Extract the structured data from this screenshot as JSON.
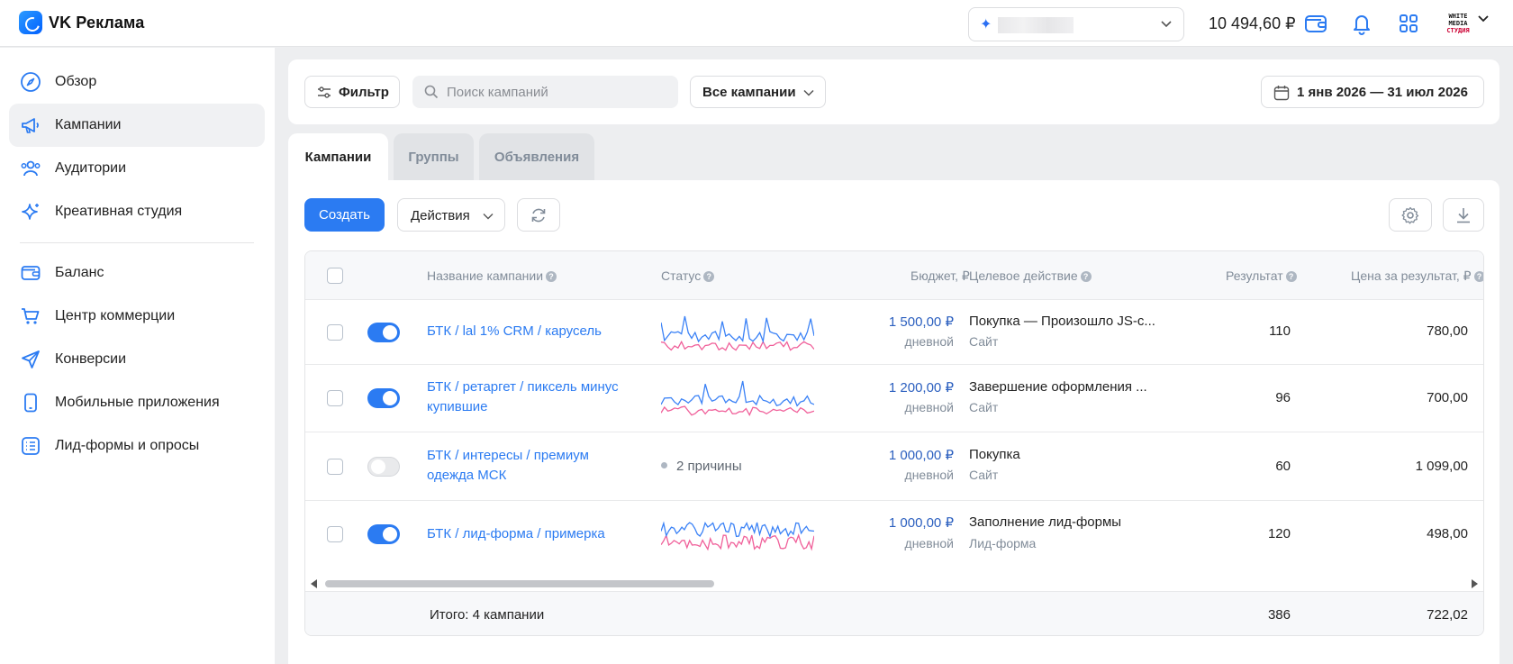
{
  "header": {
    "app_name": "VK Реклама",
    "balance": "10 494,60 ₽",
    "avatar_logo": [
      "WHITE",
      "MEDIA",
      "СТУДИЯ"
    ]
  },
  "sidebar": {
    "items": [
      {
        "label": "Обзор",
        "icon": "compass-icon"
      },
      {
        "label": "Кампании",
        "icon": "megaphone-icon",
        "active": true
      },
      {
        "label": "Аудитории",
        "icon": "users-icon"
      },
      {
        "label": "Креативная студия",
        "icon": "sparkle-icon"
      },
      {
        "label": "Баланс",
        "icon": "wallet-icon"
      },
      {
        "label": "Центр коммерции",
        "icon": "cart-icon"
      },
      {
        "label": "Конверсии",
        "icon": "send-icon"
      },
      {
        "label": "Мобильные приложения",
        "icon": "phone-icon"
      },
      {
        "label": "Лид-формы и опросы",
        "icon": "list-icon"
      }
    ]
  },
  "filterbar": {
    "filter_label": "Фильтр",
    "search_placeholder": "Поиск кампаний",
    "campaigns_select": "Все кампании",
    "date_range": "1 янв 2026 — 31 июл 2026"
  },
  "tabs": [
    {
      "label": "Кампании",
      "active": true
    },
    {
      "label": "Группы"
    },
    {
      "label": "Объявления"
    }
  ],
  "toolbar": {
    "create_label": "Создать",
    "actions_label": "Действия"
  },
  "table": {
    "columns": {
      "name": "Название кампании",
      "status": "Статус",
      "budget": "Бюджет, ₽",
      "goal": "Целевое действие",
      "result": "Результат",
      "price": "Цена за результат, ₽"
    },
    "rows": [
      {
        "name": "БТК / lal 1% CRM / карусель",
        "enabled": true,
        "status": "",
        "budget": "1 500,00 ₽",
        "budget_period": "дневной",
        "goal": "Покупка — Произошло JS-с...",
        "goal_sub": "Сайт",
        "result": "110",
        "price": "780,00"
      },
      {
        "name": "БТК / ретаргет / пиксель минус купившие",
        "enabled": true,
        "status": "",
        "budget": "1 200,00 ₽",
        "budget_period": "дневной",
        "goal": "Завершение оформления ...",
        "goal_sub": "Сайт",
        "result": "96",
        "price": "700,00"
      },
      {
        "name": "БТК / интересы / премиум одежда МСК",
        "enabled": false,
        "status": "2 причины",
        "budget": "1 000,00 ₽",
        "budget_period": "дневной",
        "goal": "Покупка",
        "goal_sub": "Сайт",
        "result": "60",
        "price": "1 099,00"
      },
      {
        "name": "БТК / лид-форма / примерка",
        "enabled": true,
        "status": "",
        "budget": "1 000,00 ₽",
        "budget_period": "дневной",
        "goal": "Заполнение лид-формы",
        "goal_sub": "Лид-форма",
        "result": "120",
        "price": "498,00"
      }
    ],
    "footer": {
      "total_label": "Итого: 4 кампании",
      "total_result": "386",
      "total_price": "722,02"
    }
  },
  "colors": {
    "accent": "#2b7bf2",
    "spark_blue": "#3b82f6",
    "spark_pink": "#f0609a"
  }
}
